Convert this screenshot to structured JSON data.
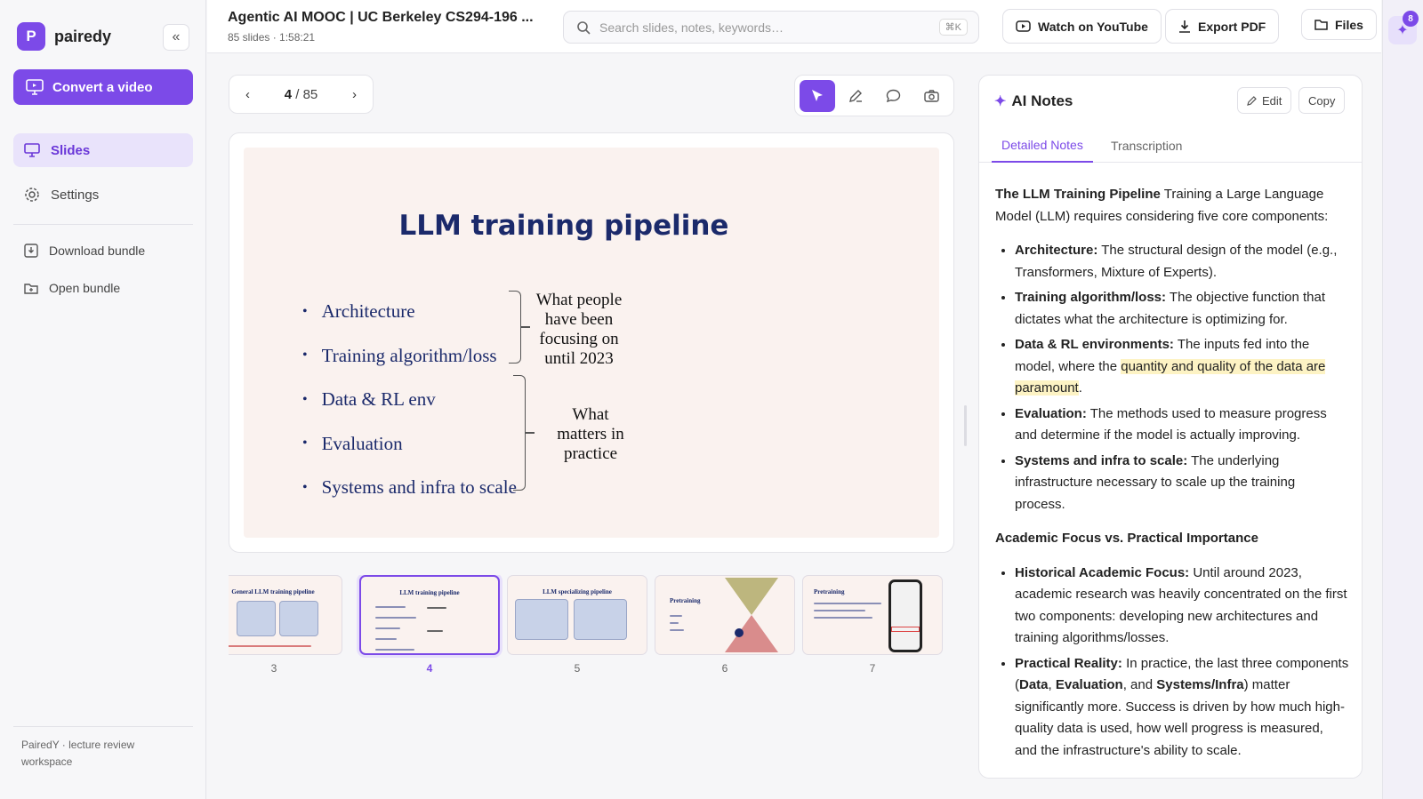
{
  "brand": {
    "logo_letter": "P",
    "name": "pairedy",
    "collapse_icon": "«"
  },
  "sidebar": {
    "convert_label": "Convert a video",
    "nav": [
      {
        "label": "Slides",
        "icon": "monitor-icon",
        "active": true
      },
      {
        "label": "Settings",
        "icon": "gear-icon",
        "active": false
      }
    ],
    "bundle": [
      {
        "label": "Download bundle",
        "icon": "download-box-icon"
      },
      {
        "label": "Open bundle",
        "icon": "folder-icon"
      }
    ],
    "footer": "PairedY · lecture review workspace"
  },
  "header": {
    "title": "Agentic AI MOOC | UC Berkeley CS294-196 ...",
    "meta": "85 slides · 1:58:21",
    "search_placeholder": "Search slides, notes, keywords…",
    "search_shortcut": "⌘K",
    "buttons": {
      "youtube": "Watch on YouTube",
      "export": "Export PDF",
      "files": "Files"
    }
  },
  "rail": {
    "badge": "8"
  },
  "pager": {
    "current": "4",
    "total": "/ 85"
  },
  "slide": {
    "title": "LLM training pipeline",
    "bullets": [
      "Architecture",
      "Training algorithm/loss",
      "Data & RL env",
      "Evaluation",
      "Systems and infra to scale"
    ],
    "note_top": [
      "What people",
      "have been",
      "focusing on",
      "until 2023"
    ],
    "note_bottom": [
      "What",
      "matters in",
      "practice"
    ]
  },
  "thumbnails": [
    {
      "num": "3",
      "title": "General LLM training pipeline",
      "active": false
    },
    {
      "num": "4",
      "title": "LLM training pipeline",
      "active": true
    },
    {
      "num": "5",
      "title": "LLM specializing pipeline",
      "active": false
    },
    {
      "num": "6",
      "title": "Pretraining",
      "active": false
    },
    {
      "num": "7",
      "title": "Pretraining",
      "active": false
    }
  ],
  "notes": {
    "title": "AI Notes",
    "edit": "Edit",
    "copy": "Copy",
    "tabs": [
      "Detailed Notes",
      "Transcription"
    ],
    "intro_bold": "The LLM Training Pipeline",
    "intro_text": " Training a Large Language Model (LLM) requires considering five core components:",
    "components": [
      {
        "term": "Architecture:",
        "text": " The structural design of the model (e.g., Transformers, Mixture of Experts)."
      },
      {
        "term": "Training algorithm/loss:",
        "text": " The objective function that dictates what the architecture is optimizing for."
      },
      {
        "term": "Data & RL environments:",
        "text_pre": " The inputs fed into the model, where the ",
        "highlight": "quantity and quality of the data are paramount",
        "text_post": "."
      },
      {
        "term": "Evaluation:",
        "text": " The methods used to measure progress and determine if the model is actually improving."
      },
      {
        "term": "Systems and infra to scale:",
        "text": " The underlying infrastructure necessary to scale up the training process."
      }
    ],
    "section2": "Academic Focus vs. Practical Importance",
    "focus": [
      {
        "term": "Historical Academic Focus:",
        "text": " Until around 2023, academic research was heavily concentrated on the first two components: developing new architectures and training algorithms/losses."
      }
    ],
    "reality": {
      "term": "Practical Reality:",
      "t1": " In practice, the last three components (",
      "b1": "Data",
      "t2": ", ",
      "b2": "Evaluation",
      "t3": ", and ",
      "b3": "Systems/Infra",
      "t4": ") matter significantly more. Success is driven by how much high-quality data is used, how well progress is measured, and the infrastructure's ability to scale."
    }
  }
}
